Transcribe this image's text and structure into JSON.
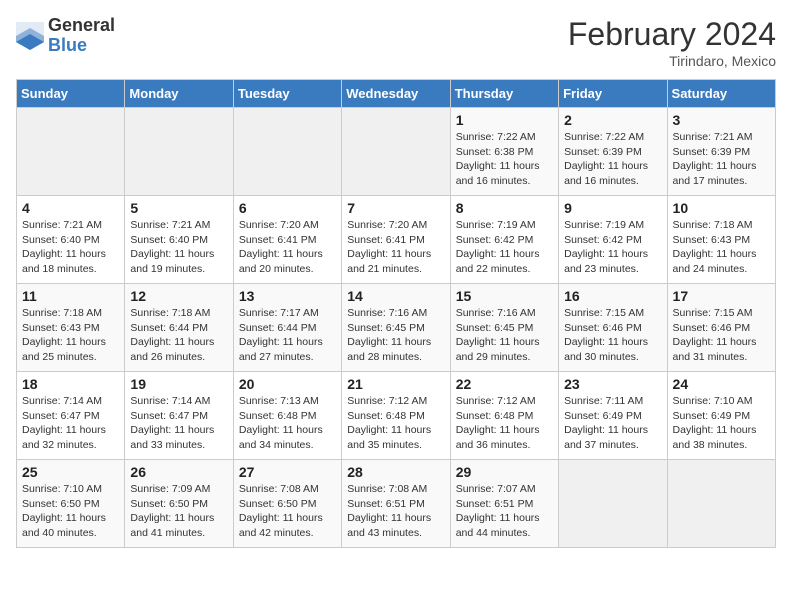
{
  "logo": {
    "general": "General",
    "blue": "Blue"
  },
  "title": "February 2024",
  "subtitle": "Tirindaro, Mexico",
  "days_header": [
    "Sunday",
    "Monday",
    "Tuesday",
    "Wednesday",
    "Thursday",
    "Friday",
    "Saturday"
  ],
  "weeks": [
    [
      {
        "day": "",
        "info": ""
      },
      {
        "day": "",
        "info": ""
      },
      {
        "day": "",
        "info": ""
      },
      {
        "day": "",
        "info": ""
      },
      {
        "day": "1",
        "info": "Sunrise: 7:22 AM\nSunset: 6:38 PM\nDaylight: 11 hours and 16 minutes."
      },
      {
        "day": "2",
        "info": "Sunrise: 7:22 AM\nSunset: 6:39 PM\nDaylight: 11 hours and 16 minutes."
      },
      {
        "day": "3",
        "info": "Sunrise: 7:21 AM\nSunset: 6:39 PM\nDaylight: 11 hours and 17 minutes."
      }
    ],
    [
      {
        "day": "4",
        "info": "Sunrise: 7:21 AM\nSunset: 6:40 PM\nDaylight: 11 hours and 18 minutes."
      },
      {
        "day": "5",
        "info": "Sunrise: 7:21 AM\nSunset: 6:40 PM\nDaylight: 11 hours and 19 minutes."
      },
      {
        "day": "6",
        "info": "Sunrise: 7:20 AM\nSunset: 6:41 PM\nDaylight: 11 hours and 20 minutes."
      },
      {
        "day": "7",
        "info": "Sunrise: 7:20 AM\nSunset: 6:41 PM\nDaylight: 11 hours and 21 minutes."
      },
      {
        "day": "8",
        "info": "Sunrise: 7:19 AM\nSunset: 6:42 PM\nDaylight: 11 hours and 22 minutes."
      },
      {
        "day": "9",
        "info": "Sunrise: 7:19 AM\nSunset: 6:42 PM\nDaylight: 11 hours and 23 minutes."
      },
      {
        "day": "10",
        "info": "Sunrise: 7:18 AM\nSunset: 6:43 PM\nDaylight: 11 hours and 24 minutes."
      }
    ],
    [
      {
        "day": "11",
        "info": "Sunrise: 7:18 AM\nSunset: 6:43 PM\nDaylight: 11 hours and 25 minutes."
      },
      {
        "day": "12",
        "info": "Sunrise: 7:18 AM\nSunset: 6:44 PM\nDaylight: 11 hours and 26 minutes."
      },
      {
        "day": "13",
        "info": "Sunrise: 7:17 AM\nSunset: 6:44 PM\nDaylight: 11 hours and 27 minutes."
      },
      {
        "day": "14",
        "info": "Sunrise: 7:16 AM\nSunset: 6:45 PM\nDaylight: 11 hours and 28 minutes."
      },
      {
        "day": "15",
        "info": "Sunrise: 7:16 AM\nSunset: 6:45 PM\nDaylight: 11 hours and 29 minutes."
      },
      {
        "day": "16",
        "info": "Sunrise: 7:15 AM\nSunset: 6:46 PM\nDaylight: 11 hours and 30 minutes."
      },
      {
        "day": "17",
        "info": "Sunrise: 7:15 AM\nSunset: 6:46 PM\nDaylight: 11 hours and 31 minutes."
      }
    ],
    [
      {
        "day": "18",
        "info": "Sunrise: 7:14 AM\nSunset: 6:47 PM\nDaylight: 11 hours and 32 minutes."
      },
      {
        "day": "19",
        "info": "Sunrise: 7:14 AM\nSunset: 6:47 PM\nDaylight: 11 hours and 33 minutes."
      },
      {
        "day": "20",
        "info": "Sunrise: 7:13 AM\nSunset: 6:48 PM\nDaylight: 11 hours and 34 minutes."
      },
      {
        "day": "21",
        "info": "Sunrise: 7:12 AM\nSunset: 6:48 PM\nDaylight: 11 hours and 35 minutes."
      },
      {
        "day": "22",
        "info": "Sunrise: 7:12 AM\nSunset: 6:48 PM\nDaylight: 11 hours and 36 minutes."
      },
      {
        "day": "23",
        "info": "Sunrise: 7:11 AM\nSunset: 6:49 PM\nDaylight: 11 hours and 37 minutes."
      },
      {
        "day": "24",
        "info": "Sunrise: 7:10 AM\nSunset: 6:49 PM\nDaylight: 11 hours and 38 minutes."
      }
    ],
    [
      {
        "day": "25",
        "info": "Sunrise: 7:10 AM\nSunset: 6:50 PM\nDaylight: 11 hours and 40 minutes."
      },
      {
        "day": "26",
        "info": "Sunrise: 7:09 AM\nSunset: 6:50 PM\nDaylight: 11 hours and 41 minutes."
      },
      {
        "day": "27",
        "info": "Sunrise: 7:08 AM\nSunset: 6:50 PM\nDaylight: 11 hours and 42 minutes."
      },
      {
        "day": "28",
        "info": "Sunrise: 7:08 AM\nSunset: 6:51 PM\nDaylight: 11 hours and 43 minutes."
      },
      {
        "day": "29",
        "info": "Sunrise: 7:07 AM\nSunset: 6:51 PM\nDaylight: 11 hours and 44 minutes."
      },
      {
        "day": "",
        "info": ""
      },
      {
        "day": "",
        "info": ""
      }
    ]
  ]
}
